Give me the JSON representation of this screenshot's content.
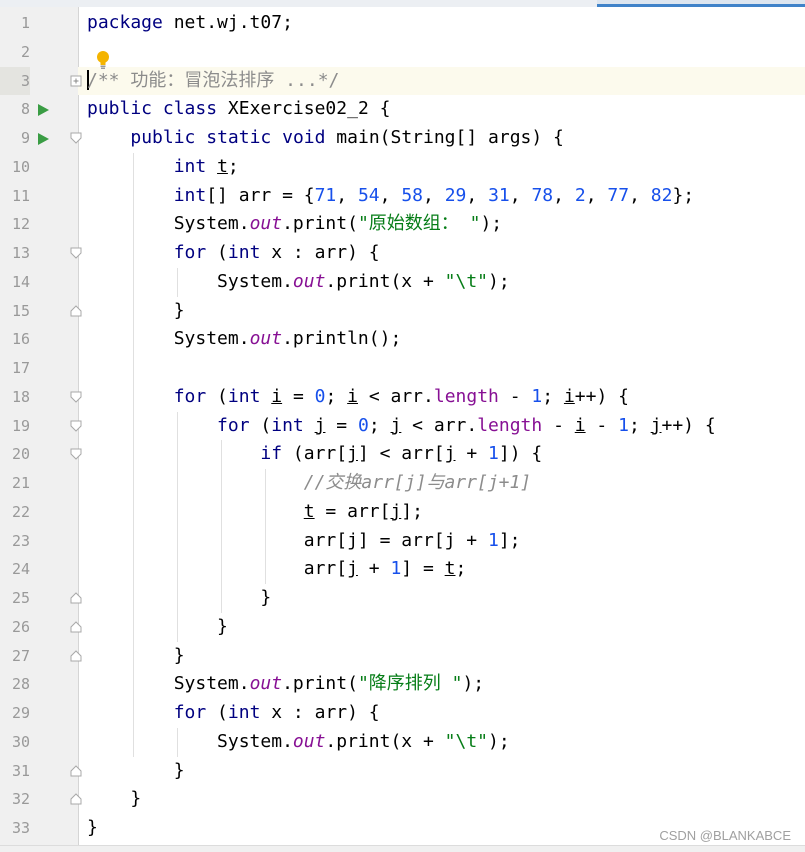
{
  "editor": {
    "language": "java",
    "current_line": 3,
    "line_numbers": [
      "1",
      "2",
      "3",
      "8",
      "9",
      "10",
      "11",
      "12",
      "13",
      "14",
      "15",
      "16",
      "17",
      "18",
      "19",
      "20",
      "21",
      "22",
      "23",
      "24",
      "25",
      "26",
      "27",
      "28",
      "29",
      "30",
      "31",
      "32",
      "33"
    ],
    "run_gutter_lines": [
      "8",
      "9"
    ],
    "lines": [
      "package net.wj.t07;",
      "",
      "/** 功能：冒泡法排序 ...*/",
      "public class XExercise02_2 {",
      "    public static void main(String[] args) {",
      "        int t;",
      "        int[] arr = {71, 54, 58, 29, 31, 78, 2, 77, 82};",
      "        System.out.print(\"原始数组： \");",
      "        for (int x : arr) {",
      "            System.out.print(x + \"\\t\");",
      "        }",
      "        System.out.println();",
      "",
      "        for (int i = 0; i < arr.length - 1; i++) {",
      "            for (int j = 0; j < arr.length - i - 1; j++) {",
      "                if (arr[j] < arr[j + 1]) {",
      "                    //交换arr[j]与arr[j+1]",
      "                    t = arr[j];",
      "                    arr[j] = arr[j + 1];",
      "                    arr[j + 1] = t;",
      "                }",
      "            }",
      "        }",
      "        System.out.print(\"降序排列 \");",
      "        for (int x : arr) {",
      "            System.out.print(x + \"\\t\");",
      "        }",
      "    }",
      "}"
    ]
  },
  "gutter_icons": {
    "run": "run-triangle-icon",
    "fold": "fold-marker-icon",
    "intention": "lightbulb-icon"
  },
  "colors": {
    "keyword": "#000080",
    "number": "#1750eb",
    "string": "#067d17",
    "static_field": "#871094",
    "comment": "#8c8c8c",
    "run_icon": "#3a9d44",
    "bulb": "#f4b400"
  },
  "watermark": "CSDN @BLANKABCE"
}
